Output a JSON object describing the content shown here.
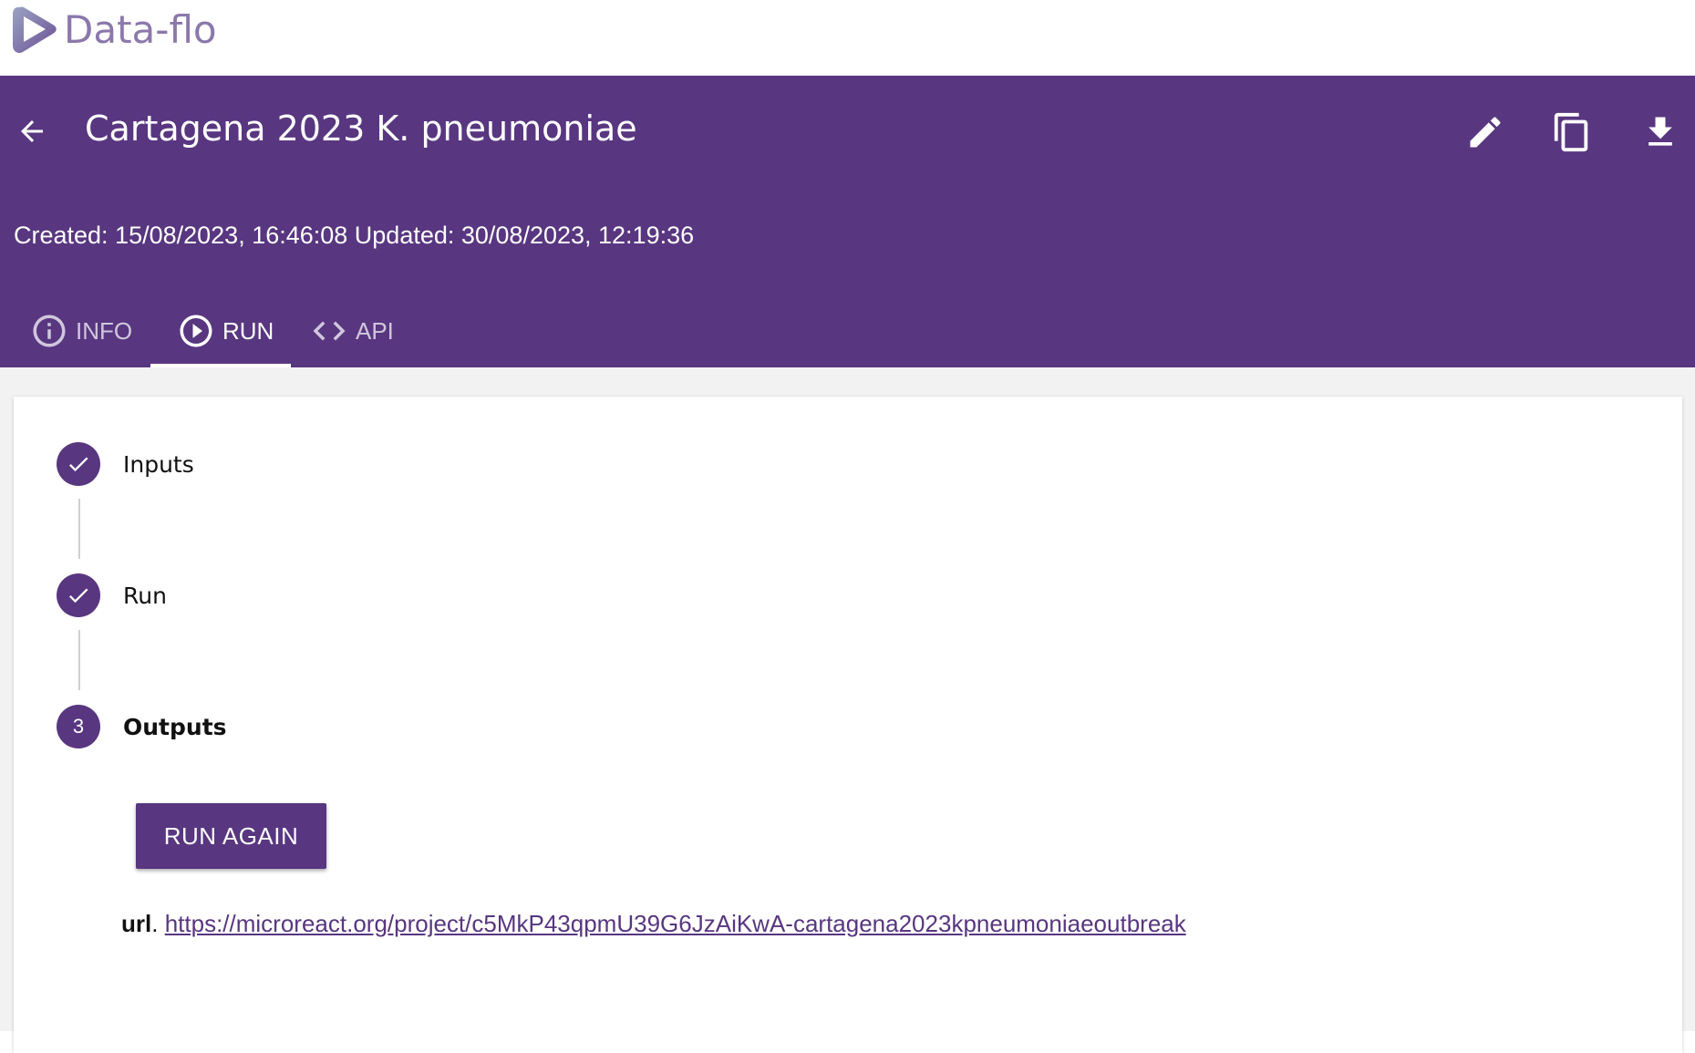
{
  "app": {
    "name": "Data-flo",
    "brand_color": "#583680",
    "logo_color": "#8b78ab"
  },
  "header": {
    "title": "Cartagena 2023 K. pneumoniae",
    "back_icon": "arrow-left-icon",
    "actions": [
      {
        "name": "edit",
        "icon": "pencil-icon"
      },
      {
        "name": "duplicate",
        "icon": "copy-icon"
      },
      {
        "name": "download",
        "icon": "download-icon"
      }
    ],
    "meta": "Created: 15/08/2023, 16:46:08 Updated: 30/08/2023, 12:19:36"
  },
  "tabs": [
    {
      "label": "INFO",
      "icon": "info-icon",
      "active": false
    },
    {
      "label": "RUN",
      "icon": "play-circle-icon",
      "active": true
    },
    {
      "label": "API",
      "icon": "code-icon",
      "active": false
    }
  ],
  "stepper": {
    "steps": [
      {
        "label": "Inputs",
        "state": "completed",
        "marker": "check-icon"
      },
      {
        "label": "Run",
        "state": "completed",
        "marker": "check-icon"
      },
      {
        "label": "Outputs",
        "state": "active",
        "number": "3"
      }
    ],
    "run_again_label": "RUN AGAIN",
    "output": {
      "key": "url",
      "separator": ".",
      "value": "https://microreact.org/project/c5MkP43qpmU39G6JzAiKwA-cartagena2023kpneumoniaeoutbreak"
    }
  }
}
